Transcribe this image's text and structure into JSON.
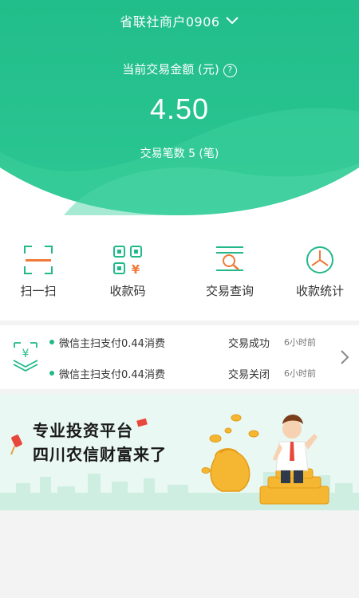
{
  "header": {
    "merchant_name": "省联社商户0906",
    "amount_label": "当前交易金额 (元)",
    "amount": "4.50",
    "count_text": "交易笔数 5 (笔)",
    "help_icon": "question-circle-icon",
    "dropdown_icon": "chevron-down-icon"
  },
  "actions": [
    {
      "label": "扫一扫",
      "icon": "scan-icon"
    },
    {
      "label": "收款码",
      "icon": "qr-code-yuan-icon"
    },
    {
      "label": "交易查询",
      "icon": "search-list-icon"
    },
    {
      "label": "收款统计",
      "icon": "pie-chart-icon"
    }
  ],
  "transactions": [
    {
      "desc": "微信主扫支付0.44消费",
      "status": "交易成功",
      "time": "6小时前"
    },
    {
      "desc": "微信主扫支付0.44消费",
      "status": "交易关闭",
      "time": "6小时前"
    }
  ],
  "banner": {
    "line1": "专业投资平台",
    "line2": "四川农信财富来了"
  },
  "colors": {
    "brand_green": "#25c48e",
    "accent": "#22b98a"
  }
}
